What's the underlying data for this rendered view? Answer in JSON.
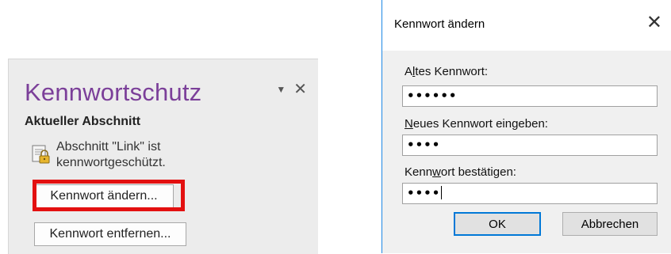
{
  "task_pane": {
    "title": "Kennwortschutz",
    "dropdown_glyph": "▼",
    "close_glyph": "✕",
    "section_header": "Aktueller Abschnitt",
    "status_line1": "Abschnitt \"Link\" ist",
    "status_line2": "kennwortgeschützt.",
    "change_password_button": "Kennwort ändern...",
    "remove_password_button": "Kennwort entfernen...",
    "highlight_color": "#e31010",
    "title_color": "#7b3f99"
  },
  "dialog": {
    "title": "Kennwort ändern",
    "close_glyph": "✕",
    "old_password": {
      "label_pre": "A",
      "label_key": "l",
      "label_post": "tes Kennwort:",
      "value": "••••••"
    },
    "new_password": {
      "label_pre": "",
      "label_key": "N",
      "label_post": "eues Kennwort eingeben:",
      "value": "••••"
    },
    "confirm_password": {
      "label_pre": "Kenn",
      "label_key": "w",
      "label_post": "ort bestätigen:",
      "value": "••••"
    },
    "ok_button": "OK",
    "cancel_button": "Abbrechen",
    "accent_color": "#0078d7"
  }
}
